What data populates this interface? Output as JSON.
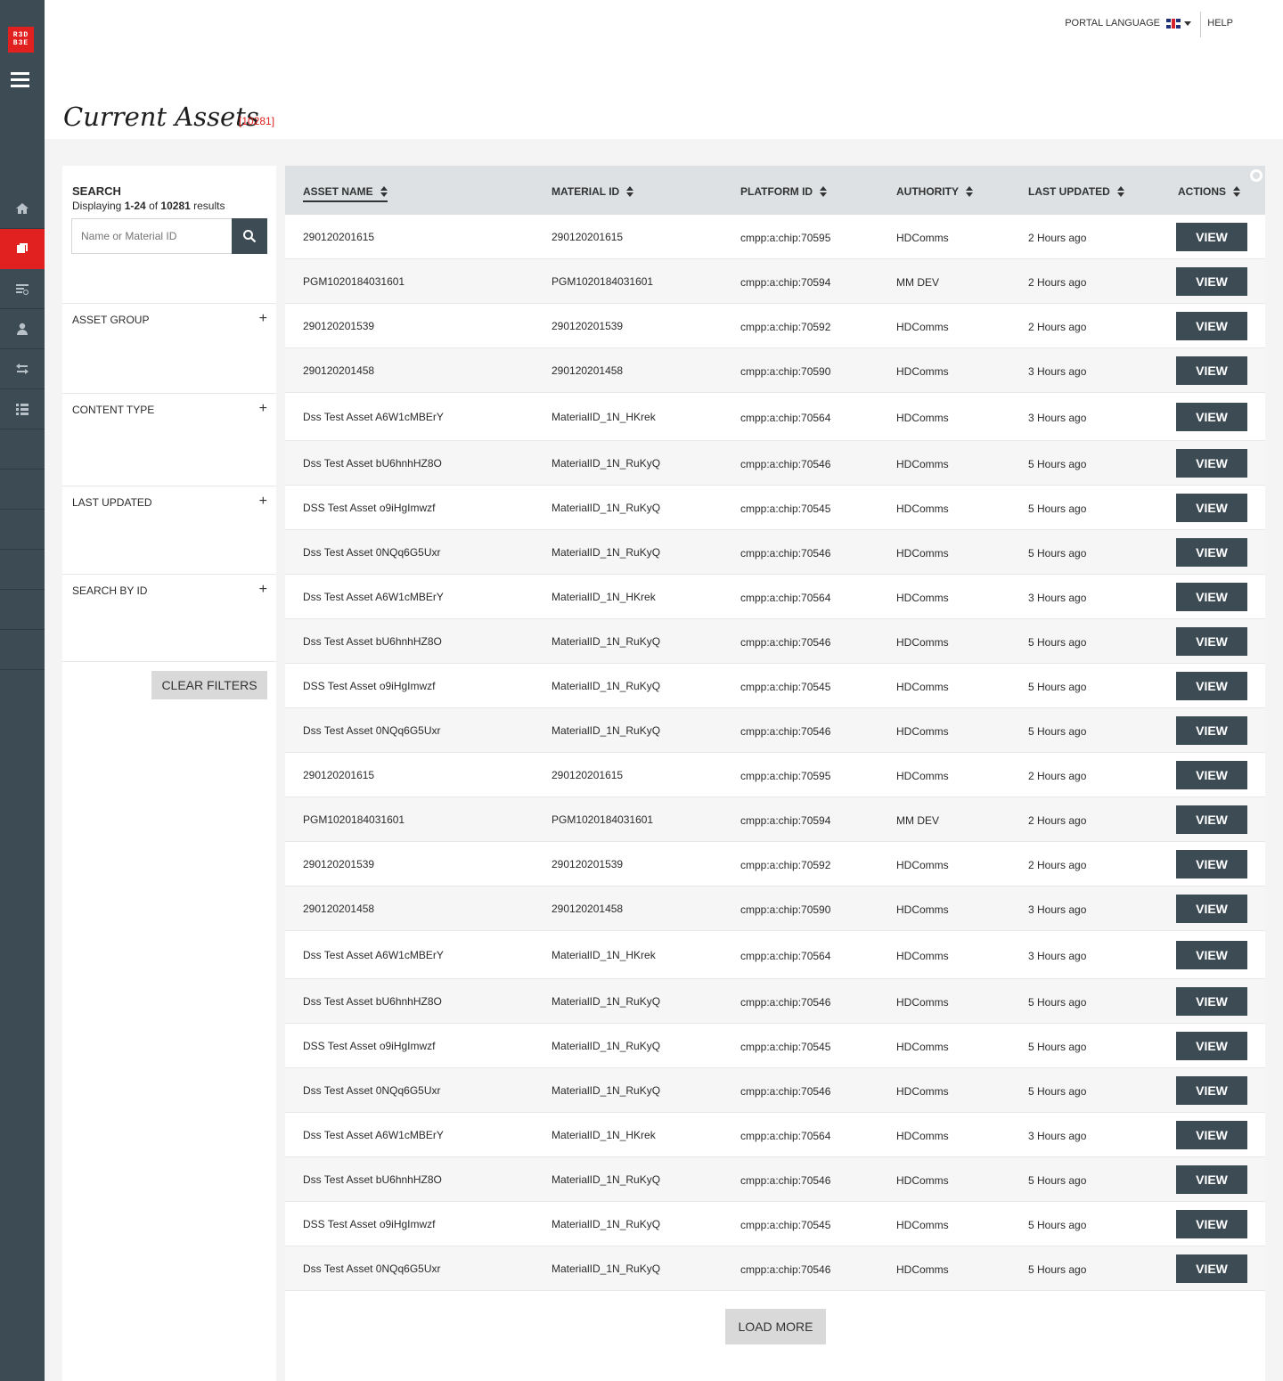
{
  "logo": {
    "text": "RED BEE"
  },
  "topbar": {
    "language_label": "PORTAL LANGUAGE",
    "help_label": "HELP"
  },
  "page": {
    "title": "Current Assets",
    "count": "[10281]"
  },
  "filters": {
    "search_heading": "SEARCH",
    "displaying_prefix": "Displaying ",
    "displaying_range": "1-24",
    "displaying_of": " of ",
    "displaying_total": "10281",
    "displaying_suffix": " results",
    "search_placeholder": "Name or Material ID",
    "sections": [
      "ASSET GROUP",
      "CONTENT TYPE",
      "LAST UPDATED",
      "SEARCH BY ID"
    ],
    "clear_label": "CLEAR FILTERS"
  },
  "table": {
    "columns": [
      "ASSET NAME",
      "MATERIAL ID",
      "PLATFORM ID",
      "AUTHORITY",
      "LAST UPDATED",
      "ACTIONS"
    ],
    "view_label": "VIEW",
    "load_more_label": "LOAD MORE",
    "rows": [
      [
        "290120201615",
        "290120201615",
        "cmpp:a:chip:70595",
        "HDComms",
        "2 Hours ago"
      ],
      [
        "PGM1020184031601",
        "PGM1020184031601",
        "cmpp:a:chip:70594",
        "MM DEV",
        "2 Hours ago"
      ],
      [
        "290120201539",
        "290120201539",
        "cmpp:a:chip:70592",
        "HDComms",
        "2 Hours ago"
      ],
      [
        "290120201458",
        "290120201458",
        "cmpp:a:chip:70590",
        "HDComms",
        "3 Hours ago"
      ],
      [
        "Dss Test Asset A6W1cMBErY",
        "MaterialID_1N_HKrek",
        "cmpp:a:chip:70564",
        "HDComms",
        "3 Hours ago"
      ],
      [
        "Dss Test Asset bU6hnhHZ8O",
        "MaterialID_1N_RuKyQ",
        "cmpp:a:chip:70546",
        "HDComms",
        "5 Hours ago"
      ],
      [
        "DSS Test Asset o9iHgImwzf",
        "MaterialID_1N_RuKyQ",
        "cmpp:a:chip:70545",
        "HDComms",
        "5 Hours ago"
      ],
      [
        "Dss Test Asset 0NQq6G5Uxr",
        "MaterialID_1N_RuKyQ",
        "cmpp:a:chip:70546",
        "HDComms",
        "5 Hours ago"
      ],
      [
        "Dss Test Asset A6W1cMBErY",
        "MaterialID_1N_HKrek",
        "cmpp:a:chip:70564",
        "HDComms",
        "3 Hours ago"
      ],
      [
        "Dss Test Asset bU6hnhHZ8O",
        "MaterialID_1N_RuKyQ",
        "cmpp:a:chip:70546",
        "HDComms",
        "5 Hours ago"
      ],
      [
        "DSS Test Asset o9iHgImwzf",
        "MaterialID_1N_RuKyQ",
        "cmpp:a:chip:70545",
        "HDComms",
        "5 Hours ago"
      ],
      [
        "Dss Test Asset 0NQq6G5Uxr",
        "MaterialID_1N_RuKyQ",
        "cmpp:a:chip:70546",
        "HDComms",
        "5 Hours ago"
      ],
      [
        "290120201615",
        "290120201615",
        "cmpp:a:chip:70595",
        "HDComms",
        "2 Hours ago"
      ],
      [
        "PGM1020184031601",
        "PGM1020184031601",
        "cmpp:a:chip:70594",
        "MM DEV",
        "2 Hours ago"
      ],
      [
        "290120201539",
        "290120201539",
        "cmpp:a:chip:70592",
        "HDComms",
        "2 Hours ago"
      ],
      [
        "290120201458",
        "290120201458",
        "cmpp:a:chip:70590",
        "HDComms",
        "3 Hours ago"
      ],
      [
        "Dss Test Asset A6W1cMBErY",
        "MaterialID_1N_HKrek",
        "cmpp:a:chip:70564",
        "HDComms",
        "3 Hours ago"
      ],
      [
        "Dss Test Asset bU6hnhHZ8O",
        "MaterialID_1N_RuKyQ",
        "cmpp:a:chip:70546",
        "HDComms",
        "5 Hours ago"
      ],
      [
        "DSS Test Asset o9iHgImwzf",
        "MaterialID_1N_RuKyQ",
        "cmpp:a:chip:70545",
        "HDComms",
        "5 Hours ago"
      ],
      [
        "Dss Test Asset 0NQq6G5Uxr",
        "MaterialID_1N_RuKyQ",
        "cmpp:a:chip:70546",
        "HDComms",
        "5 Hours ago"
      ],
      [
        "Dss Test Asset A6W1cMBErY",
        "MaterialID_1N_HKrek",
        "cmpp:a:chip:70564",
        "HDComms",
        "3 Hours ago"
      ],
      [
        "Dss Test Asset bU6hnhHZ8O",
        "MaterialID_1N_RuKyQ",
        "cmpp:a:chip:70546",
        "HDComms",
        "5 Hours ago"
      ],
      [
        "DSS Test Asset o9iHgImwzf",
        "MaterialID_1N_RuKyQ",
        "cmpp:a:chip:70545",
        "HDComms",
        "5 Hours ago"
      ],
      [
        "Dss Test Asset 0NQq6G5Uxr",
        "MaterialID_1N_RuKyQ",
        "cmpp:a:chip:70546",
        "HDComms",
        "5 Hours ago"
      ]
    ]
  },
  "icons": {
    "nav": [
      "home-icon",
      "assets-icon",
      "schedule-icon",
      "user-icon",
      "transfer-icon",
      "list-icon"
    ],
    "accent": "#e0211f",
    "dark": "#3d4b55"
  }
}
